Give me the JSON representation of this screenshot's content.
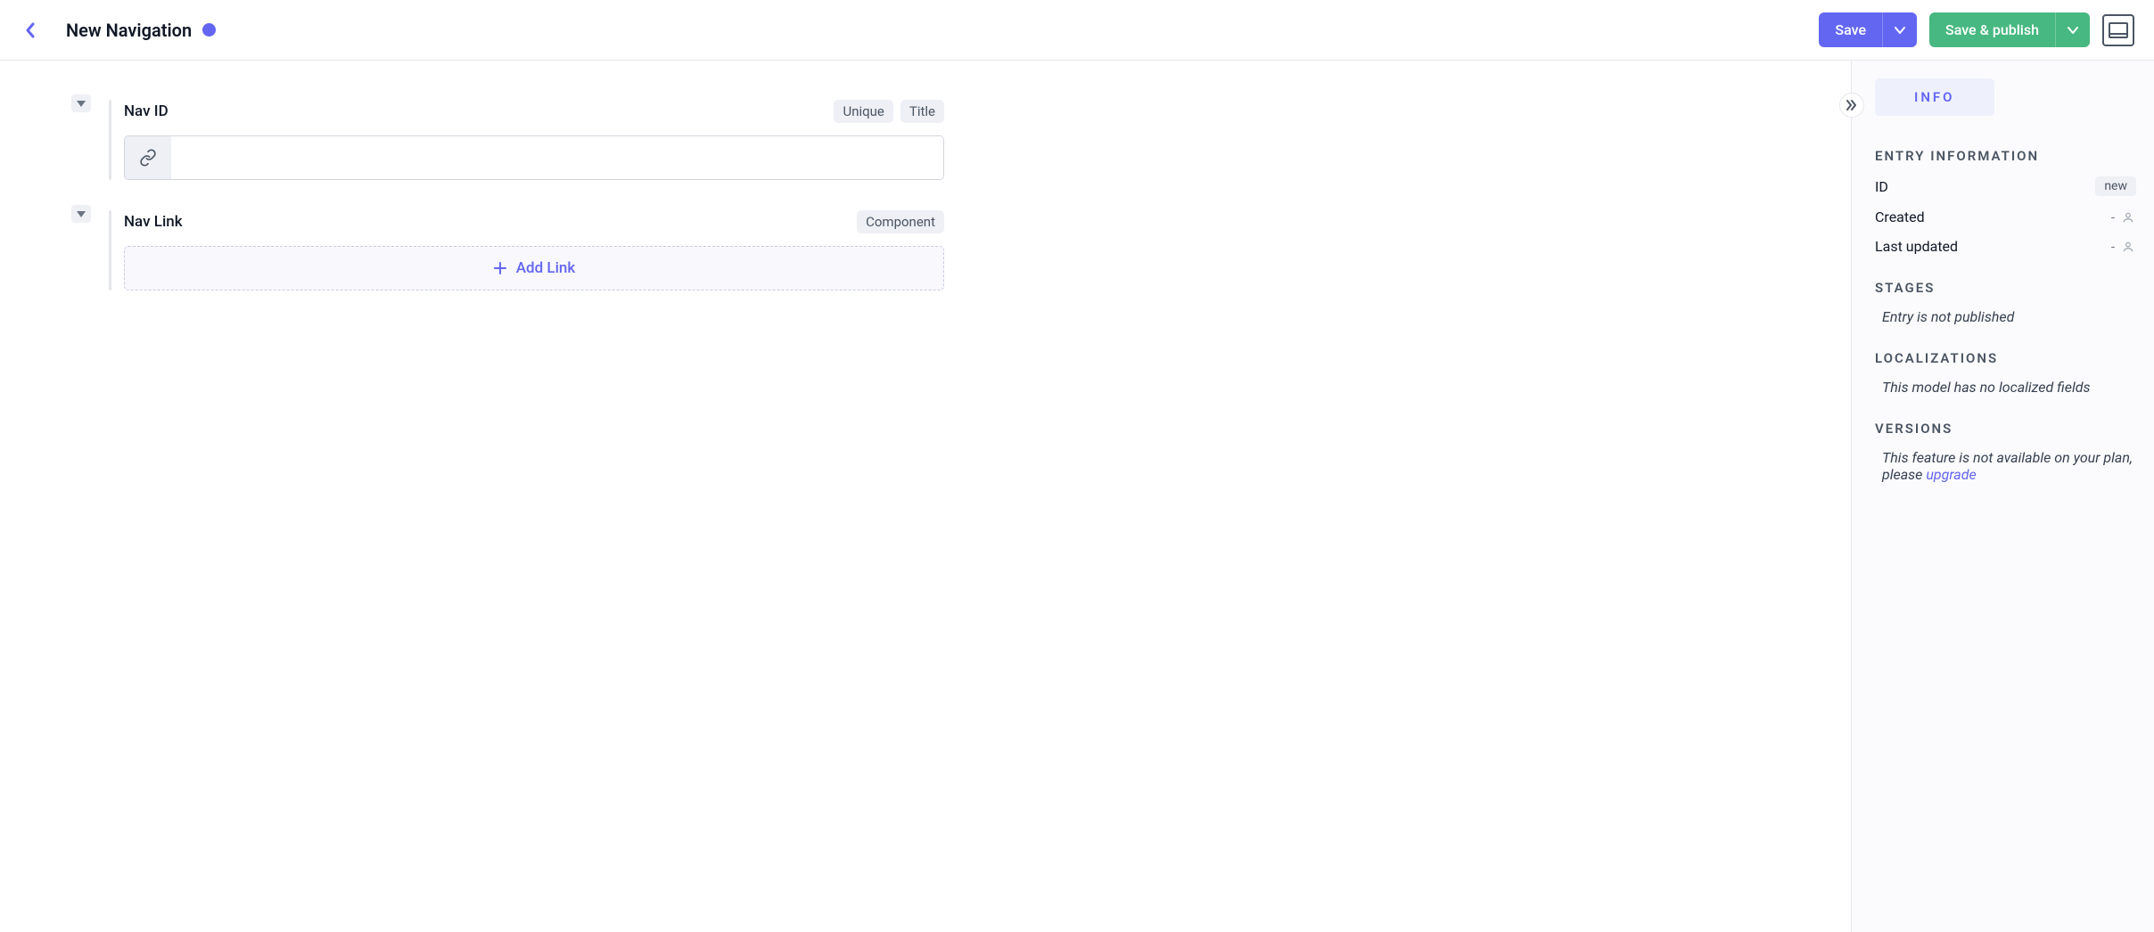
{
  "header": {
    "title": "New Navigation",
    "save_label": "Save",
    "publish_label": "Save & publish"
  },
  "fields": {
    "nav_id": {
      "label": "Nav ID",
      "badges": [
        "Unique",
        "Title"
      ],
      "value": ""
    },
    "nav_link": {
      "label": "Nav Link",
      "badges": [
        "Component"
      ],
      "add_label": "Add Link"
    }
  },
  "sidebar": {
    "tab": "INFO",
    "entry_info": {
      "heading": "ENTRY INFORMATION",
      "id_label": "ID",
      "id_value": "new",
      "created_label": "Created",
      "created_value": "-",
      "updated_label": "Last updated",
      "updated_value": "-"
    },
    "stages": {
      "heading": "STAGES",
      "text": "Entry is not published"
    },
    "localizations": {
      "heading": "LOCALIZATIONS",
      "text": "This model has no localized fields"
    },
    "versions": {
      "heading": "VERSIONS",
      "text_prefix": "This feature is not available on your plan, please ",
      "link": "upgrade"
    }
  }
}
